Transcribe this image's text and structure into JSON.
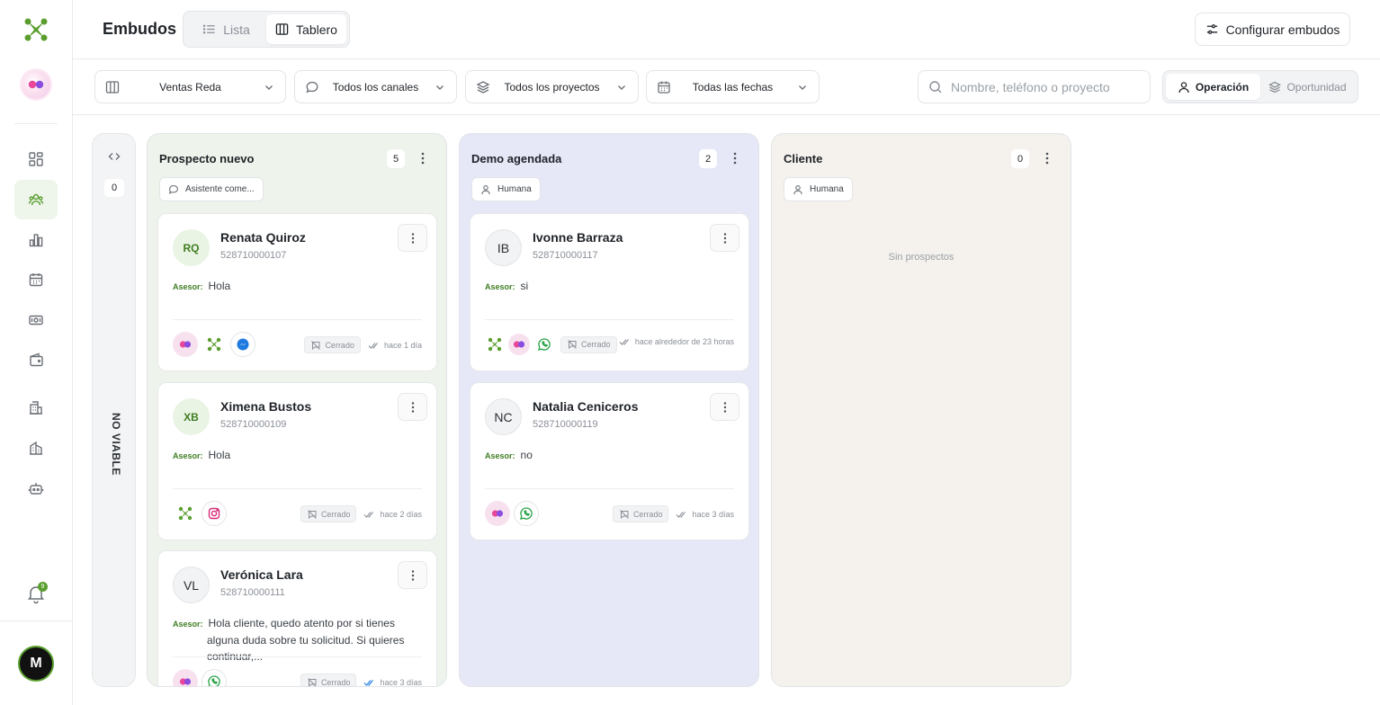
{
  "header": {
    "title": "Embudos",
    "view_toggle": {
      "list_label": "Lista",
      "board_label": "Tablero",
      "selected": "Tablero"
    },
    "config_label": "Configurar embudos"
  },
  "sidebar": {
    "notifications_count": "9",
    "user_initial": "M"
  },
  "filters": {
    "funnel": "Ventas Reda",
    "channels": "Todos los canales",
    "projects": "Todos los proyectos",
    "dates": "Todas las fechas",
    "search_placeholder": "Nombre, teléfono o proyecto",
    "mode_operation": "Operación",
    "mode_opportunity": "Oportunidad",
    "mode_selected": "Operación"
  },
  "colors": {
    "accent": "#5a9e2f",
    "col_prospect": "#eef3ec",
    "col_demo": "#e6e7f7",
    "col_client": "#f5f2ee"
  },
  "board": {
    "collapsed": {
      "title": "NO VIABLE",
      "count": "0"
    },
    "columns": [
      {
        "title": "Prospecto nuevo",
        "count": "5",
        "tag": "Asistente come...",
        "tag_icon": "chat-bubble-icon",
        "cards": [
          {
            "initials": "RQ",
            "name": "Renata Quiroz",
            "phone": "528710000107",
            "msg_label": "Asesor:",
            "msg": "Hola",
            "channels": [
              "org-logo",
              "app-logo",
              "messenger"
            ],
            "status": "Cerrado",
            "time": "hace 1 día"
          },
          {
            "initials": "XB",
            "name": "Ximena Bustos",
            "phone": "528710000109",
            "msg_label": "Asesor:",
            "msg": "Hola",
            "channels": [
              "app-logo",
              "instagram"
            ],
            "status": "Cerrado",
            "time": "hace 2 días"
          },
          {
            "initials": "VL",
            "name": "Verónica Lara",
            "phone": "528710000111",
            "msg_label": "Asesor:",
            "msg": "Hola cliente, quedo atento por si tienes alguna duda sobre tu solicitud. Si quieres continuar,...",
            "channels": [
              "org-logo",
              "whatsapp"
            ],
            "status": "Cerrado",
            "time": "hace 3 días"
          }
        ]
      },
      {
        "title": "Demo agendada",
        "count": "2",
        "tag": "Humana",
        "tag_icon": "person-icon",
        "cards": [
          {
            "initials": "IB",
            "name": "Ivonne Barraza",
            "phone": "528710000117",
            "msg_label": "Asesor:",
            "msg": "si",
            "channels": [
              "app-logo",
              "org-logo",
              "whatsapp"
            ],
            "status": "Cerrado",
            "time": "hace alrededor de 23 horas"
          },
          {
            "initials": "NC",
            "name": "Natalia Ceniceros",
            "phone": "528710000119",
            "msg_label": "Asesor:",
            "msg": "no",
            "channels": [
              "org-logo",
              "whatsapp"
            ],
            "status": "Cerrado",
            "time": "hace 3 días"
          }
        ]
      },
      {
        "title": "Cliente",
        "count": "0",
        "tag": "Humana",
        "tag_icon": "person-icon",
        "empty": "Sin prospectos"
      }
    ]
  }
}
